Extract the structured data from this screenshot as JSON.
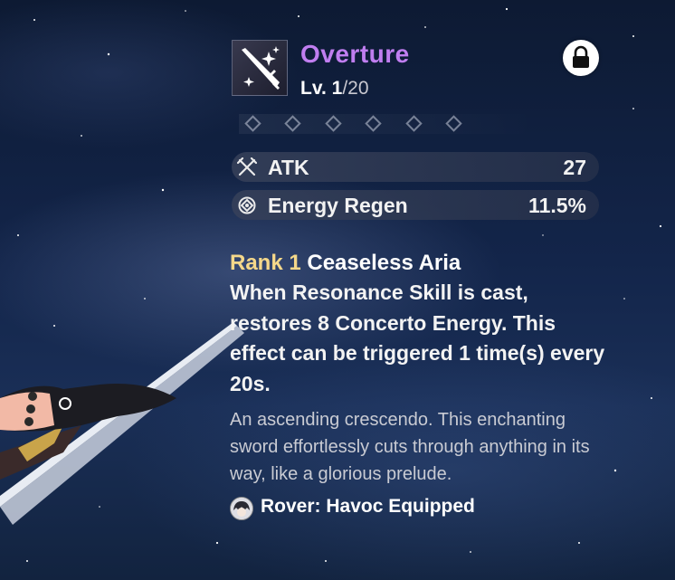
{
  "weapon": {
    "name": "Overture",
    "level_prefix": "Lv. ",
    "level_current": "1",
    "level_max": "/20",
    "icon": "sword-icon",
    "locked": true,
    "rarity_color": "#c07ef0"
  },
  "rank_slots": 6,
  "stats": [
    {
      "name": "ATK",
      "value": "27",
      "icon": "crossed-swords-icon"
    },
    {
      "name": "Energy Regen",
      "value": "11.5%",
      "icon": "energy-regen-icon"
    }
  ],
  "passive": {
    "rank_label": "Rank 1",
    "name": "Ceaseless Aria",
    "description": "When Resonance Skill is cast, restores 8 Concerto Energy. This effect can be triggered 1 time(s) every 20s.",
    "rank_color": "#f5d88a"
  },
  "flavor_text": "An ascending crescendo. This enchanting sword effortlessly cuts through anything in its way, like a glorious prelude.",
  "equipped": {
    "text": "Rover: Havoc Equipped",
    "avatar_icon": "rover-avatar"
  }
}
